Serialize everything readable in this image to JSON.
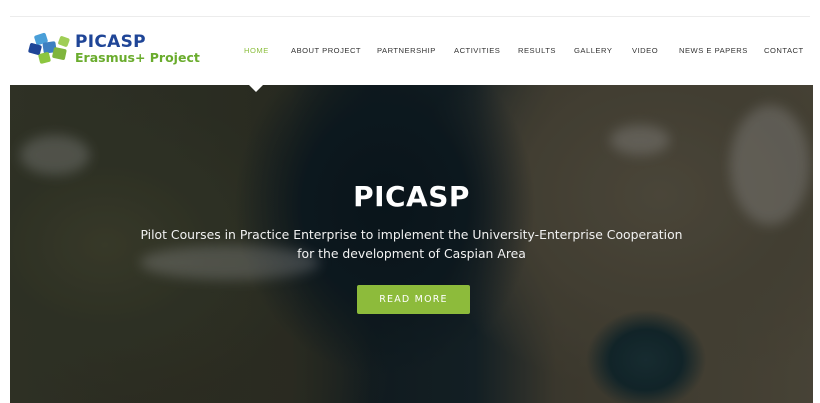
{
  "brand": {
    "title": "PICASP",
    "subtitle": "Erasmus+ Project",
    "colors": {
      "title": "#1f4597",
      "subtitle": "#6aac2d",
      "accent": "#8dbb3b"
    }
  },
  "nav": {
    "items": [
      {
        "label": "HOME",
        "active": true
      },
      {
        "label": "ABOUT PROJECT"
      },
      {
        "label": "PARTNERSHIP"
      },
      {
        "label": "ACTIVITIES"
      },
      {
        "label": "RESULTS"
      },
      {
        "label": "GALLERY"
      },
      {
        "label": "VIDEO"
      },
      {
        "label": "NEWS E PAPERS"
      },
      {
        "label": "CONTACT"
      }
    ]
  },
  "hero": {
    "title": "PICASP",
    "line1": "Pilot Courses in Practice Enterprise to implement the University-Enterprise Cooperation",
    "line2": "for the development of Caspian Area",
    "button_label": "READ MORE",
    "background": "satellite image of the Caspian Sea region"
  }
}
